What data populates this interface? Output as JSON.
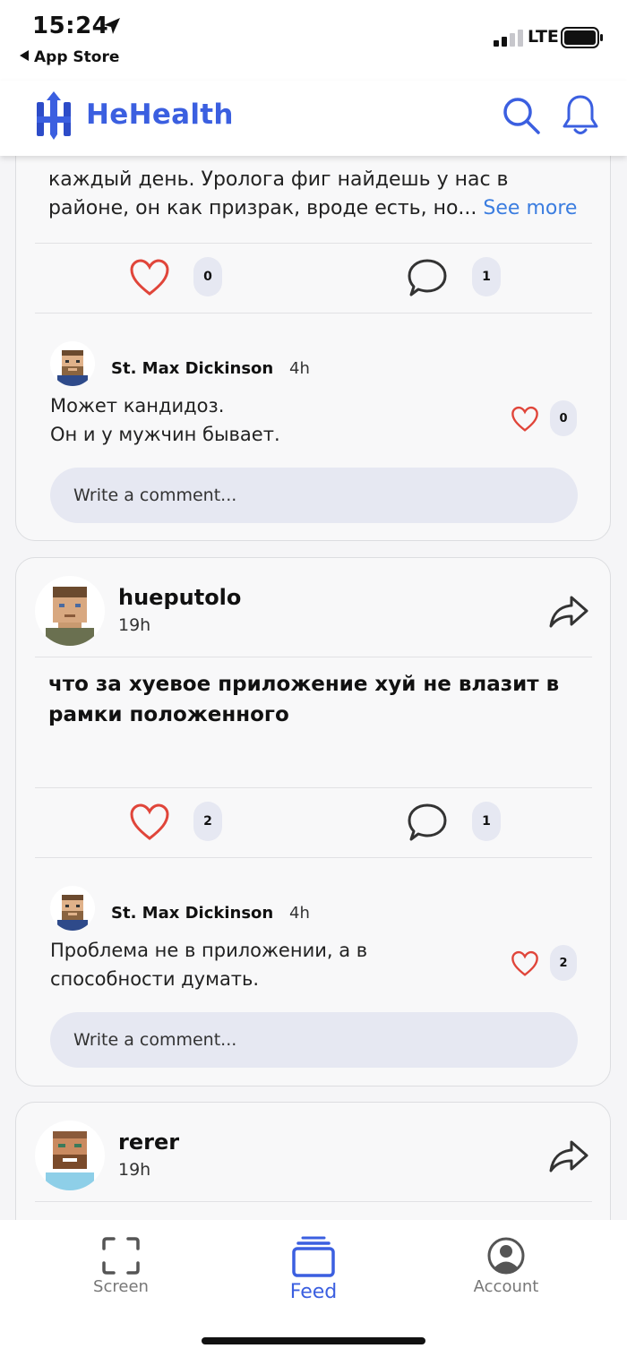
{
  "status_bar": {
    "time": "15:24",
    "back_label": "App Store",
    "network": "LTE"
  },
  "header": {
    "brand": "HeHealth",
    "icons": [
      "logo-icon",
      "search-icon",
      "bell-icon"
    ],
    "accent_color": "#3b5fe0"
  },
  "posts": [
    {
      "text_partial": "каждый день. Уролога фиг найдешь у нас в районе, он как призрак, вроде есть, но...",
      "see_more": "See more",
      "likes": "0",
      "comments": "1",
      "top_comment": {
        "author": "St. Max Dickinson",
        "time": "4h",
        "text_line1": "Может кандидоз.",
        "text_line2": "Он и у мужчин бывает.",
        "likes": "0"
      },
      "comment_placeholder": "Write a comment..."
    },
    {
      "author": "hueputolo",
      "time": "19h",
      "text": "что за хуевое приложение хуй не влазит в рамки положенного",
      "likes": "2",
      "comments": "1",
      "top_comment": {
        "author": "St. Max Dickinson",
        "time": "4h",
        "text": "Проблема не в приложении, а в способности думать.",
        "likes": "2"
      },
      "comment_placeholder": "Write a comment..."
    },
    {
      "author": "rerer",
      "time": "19h"
    }
  ],
  "tab_bar": {
    "tabs": [
      {
        "label": "Screen",
        "icon": "scan-icon",
        "active": false
      },
      {
        "label": "Feed",
        "icon": "feed-icon",
        "active": true
      },
      {
        "label": "Account",
        "icon": "account-icon",
        "active": false
      }
    ]
  },
  "colors": {
    "like_red": "#e0453a",
    "link_blue": "#3b7de0",
    "pill_bg": "#e6e8f2"
  }
}
